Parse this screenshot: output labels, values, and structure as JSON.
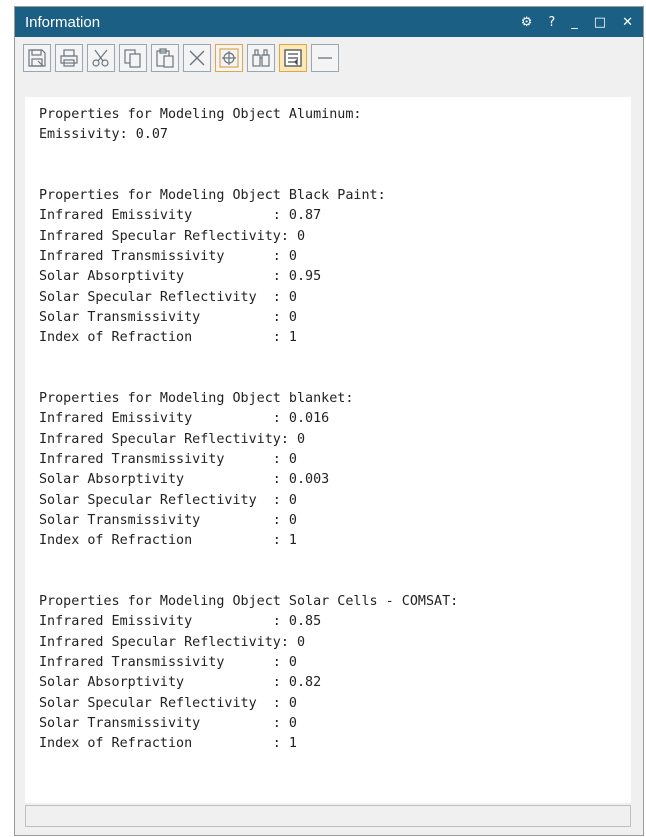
{
  "window": {
    "title": "Information",
    "controls": {
      "settings": "⚙",
      "help": "?",
      "minimize": "_",
      "maximize": "□",
      "close": "✕"
    }
  },
  "toolbar": {
    "buttons": [
      {
        "name": "save-icon"
      },
      {
        "name": "print-icon"
      },
      {
        "name": "cut-icon"
      },
      {
        "name": "copy-icon"
      },
      {
        "name": "paste-icon"
      },
      {
        "name": "delete-icon"
      },
      {
        "name": "target-icon"
      },
      {
        "name": "find-icon"
      },
      {
        "name": "word-wrap-icon",
        "active": true
      },
      {
        "name": "minus-icon"
      }
    ]
  },
  "report": {
    "text": "Properties for Modeling Object Aluminum:\nEmissivity: 0.07\n\n\nProperties for Modeling Object Black Paint:\nInfrared Emissivity          : 0.87\nInfrared Specular Reflectivity: 0\nInfrared Transmissivity      : 0\nSolar Absorptivity           : 0.95\nSolar Specular Reflectivity  : 0\nSolar Transmissivity         : 0\nIndex of Refraction          : 1\n\n\nProperties for Modeling Object blanket:\nInfrared Emissivity          : 0.016\nInfrared Specular Reflectivity: 0\nInfrared Transmissivity      : 0\nSolar Absorptivity           : 0.003\nSolar Specular Reflectivity  : 0\nSolar Transmissivity         : 0\nIndex of Refraction          : 1\n\n\nProperties for Modeling Object Solar Cells - COMSAT:\nInfrared Emissivity          : 0.85\nInfrared Specular Reflectivity: 0\nInfrared Transmissivity      : 0\nSolar Absorptivity           : 0.82\nSolar Specular Reflectivity  : 0\nSolar Transmissivity         : 0\nIndex of Refraction          : 1"
  },
  "colors": {
    "titlebar": "#1c5f84",
    "active_button": "#fde9b8"
  }
}
